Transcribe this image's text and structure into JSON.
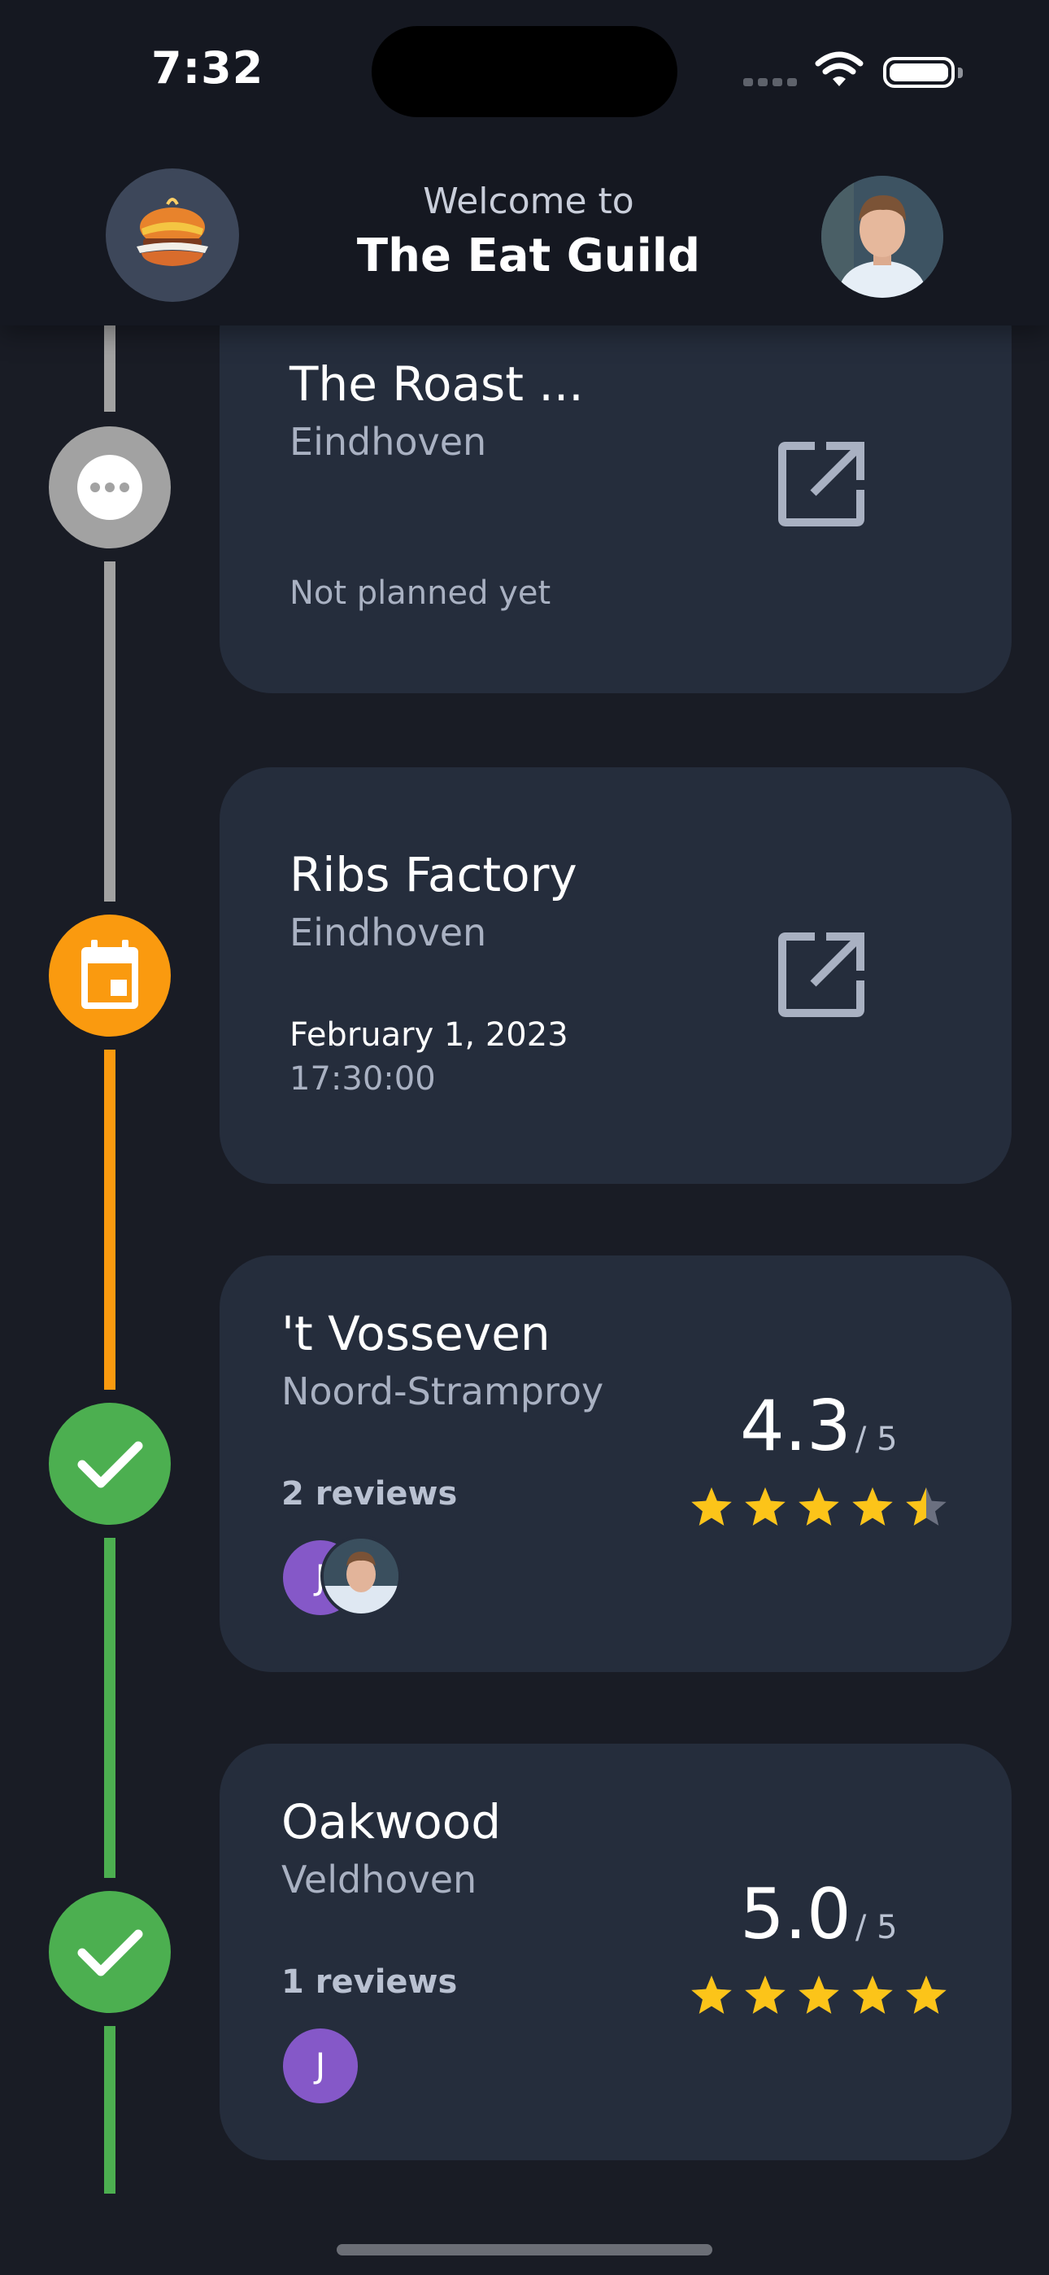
{
  "status_bar": {
    "time": "7:32"
  },
  "header": {
    "welcome": "Welcome to",
    "title": "The Eat Guild"
  },
  "restaurants": [
    {
      "name": "The Roast ...",
      "city": "Eindhoven",
      "status": "Not planned yet",
      "state": "unplanned"
    },
    {
      "name": "Ribs Factory",
      "city": "Eindhoven",
      "date": "February 1, 2023",
      "time": "17:30:00",
      "state": "planned"
    },
    {
      "name": "'t Vosseven",
      "city": "Noord-Stramproy",
      "reviews": "2 reviews",
      "rating": "4.3",
      "out_of": "/ 5",
      "stars": 4.3,
      "reviewers": [
        "J",
        "photo"
      ],
      "state": "reviewed"
    },
    {
      "name": "Oakwood",
      "city": "Veldhoven",
      "reviews": "1 reviews",
      "rating": "5.0",
      "out_of": "/ 5",
      "stars": 5.0,
      "reviewers": [
        "J"
      ],
      "state": "reviewed"
    }
  ],
  "colors": {
    "background": "#191c25",
    "card": "#252d3c",
    "unplanned": "#a2a2a2",
    "planned": "#fa9a0f",
    "reviewed": "#4caf50",
    "star": "#fcc419",
    "avatar": "#8558c8"
  },
  "icons": [
    "more-icon",
    "calendar-icon",
    "check-icon",
    "open-external-icon",
    "star-icon"
  ]
}
